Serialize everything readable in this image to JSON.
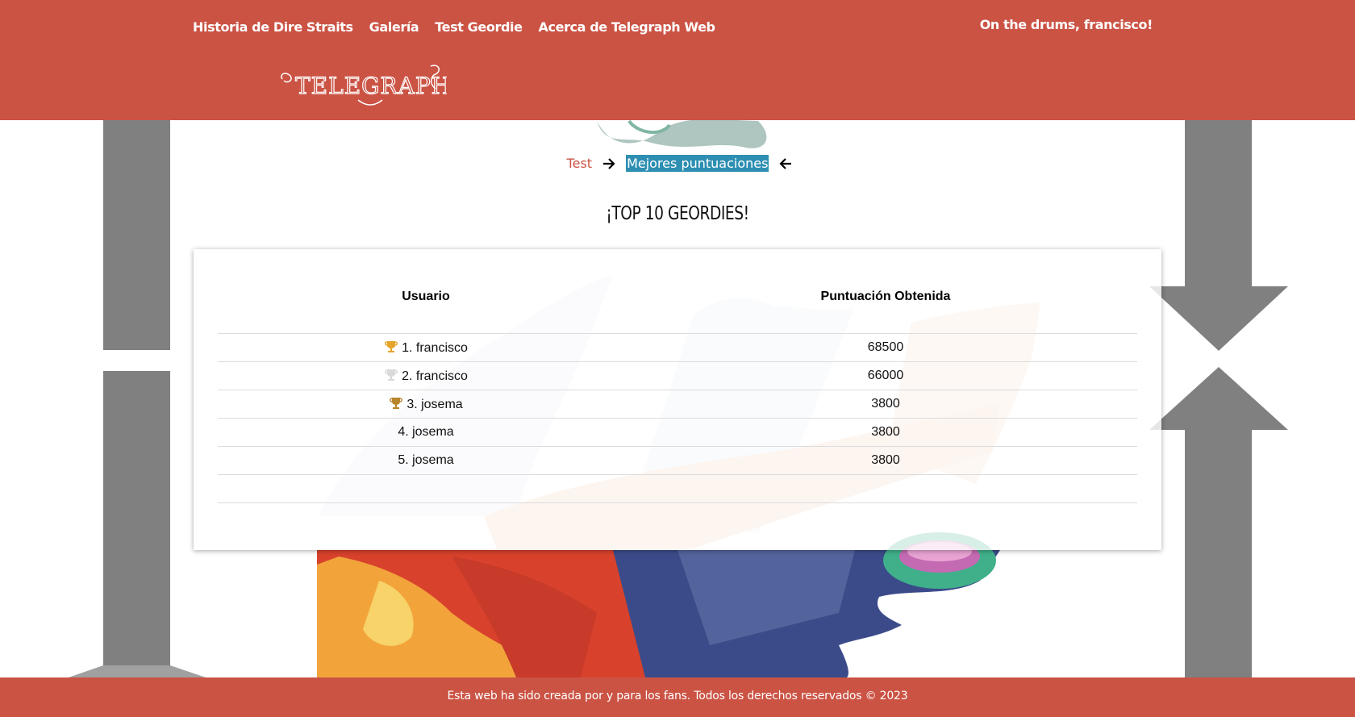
{
  "nav": {
    "items": [
      {
        "label": "Historia de Dire Straits"
      },
      {
        "label": "Galería"
      },
      {
        "label": "Test Geordie"
      },
      {
        "label": "Acerca de Telegraph Web"
      }
    ],
    "greeting": "On the drums, francisco!"
  },
  "logo": {
    "text": "TELEGRAPH WEB"
  },
  "breadcrumb": {
    "test_label": "Test",
    "current_label": "Mejores puntuaciones"
  },
  "title": "¡TOP 10 GEORDIES!",
  "table": {
    "headers": {
      "user": "Usuario",
      "score": "Puntuación Obtenida"
    },
    "rows": [
      {
        "user": "1. francisco",
        "score": "68500",
        "trophy": "gold-trophy-icon",
        "trophy_color": "#e5a52a"
      },
      {
        "user": "2. francisco",
        "score": "66000",
        "trophy": "silver-trophy-icon",
        "trophy_color": "#d9d9d9"
      },
      {
        "user": "3. josema",
        "score": "3800",
        "trophy": "bronze-trophy-icon",
        "trophy_color": "#b8862d"
      },
      {
        "user": "4. josema",
        "score": "3800"
      },
      {
        "user": "5. josema",
        "score": "3800"
      }
    ]
  },
  "footer": {
    "text": "Esta web ha sido creada por y para los fans. Todos los derechos reservados © 2023"
  },
  "colors": {
    "brand": "#cb5344",
    "highlight": "#2e8fb2",
    "decor_gray": "#808080"
  }
}
